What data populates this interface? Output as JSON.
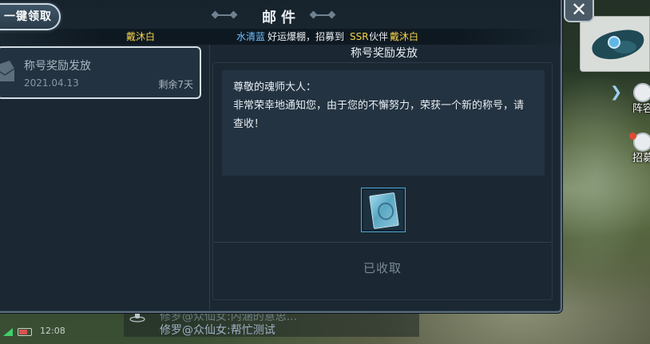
{
  "window": {
    "title": "邮件",
    "close_label": "✕"
  },
  "toolbar": {
    "claim_all_label": "一键领取"
  },
  "announcement": {
    "part1": "戴沐白",
    "part2": "水清蓝",
    "part3": "好运爆棚，招募到",
    "part4": "SSR",
    "part5": "伙伴",
    "part6": "戴沐白"
  },
  "mail_list": [
    {
      "subject": "称号奖励发放",
      "date": "2021.04.13",
      "remaining": "剩余7天"
    }
  ],
  "detail": {
    "title": "称号奖励发放",
    "greeting": "尊敬的魂师大人：",
    "body": "非常荣幸地通知您，由于您的不懈努力，荣获一个新的称号，请查收！",
    "attachment_icon": "title-card-icon",
    "status_label": "已收取"
  },
  "side": {
    "lineup_label": "阵容",
    "recruit_label": "招募"
  },
  "chat": {
    "line1": "修罗@众仙女:内涵的意思...",
    "line2": "修罗@众仙女:帮忙测试"
  },
  "status_bar": {
    "time": "12:08"
  },
  "colors": {
    "highlight_yellow": "#f3d34a",
    "highlight_blue": "#6dc0ff",
    "panel_bg": "#1b2833",
    "attachment_border": "#4fa9d4"
  }
}
